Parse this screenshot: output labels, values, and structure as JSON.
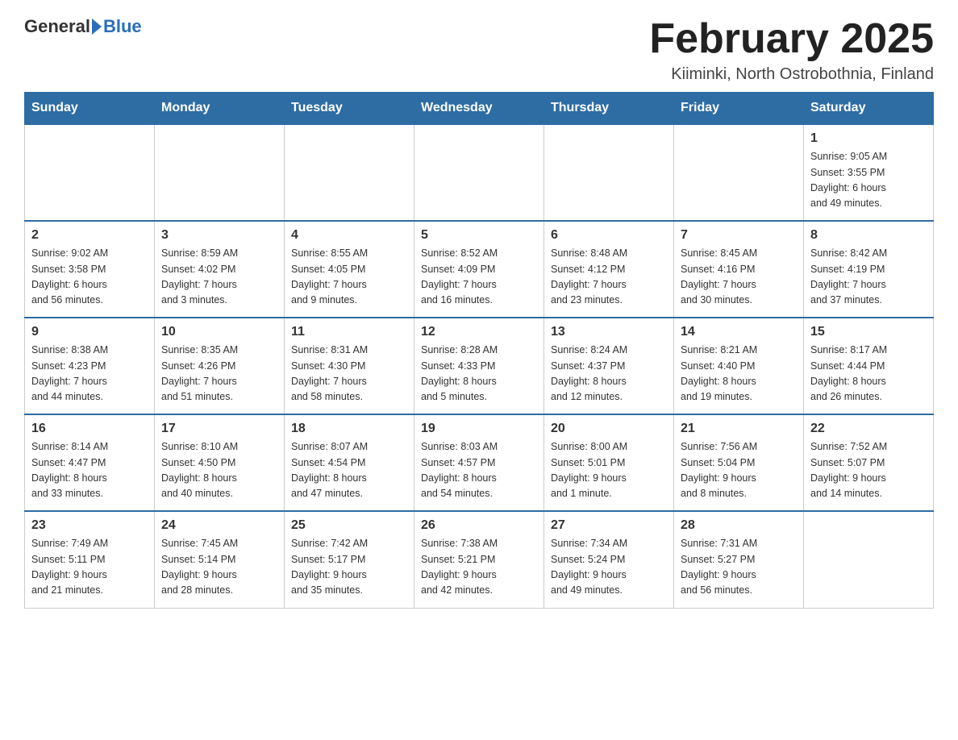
{
  "header": {
    "logo_general": "General",
    "logo_blue": "Blue",
    "month_title": "February 2025",
    "location": "Kiiminki, North Ostrobothnia, Finland"
  },
  "weekdays": [
    "Sunday",
    "Monday",
    "Tuesday",
    "Wednesday",
    "Thursday",
    "Friday",
    "Saturday"
  ],
  "weeks": [
    [
      {
        "day": "",
        "info": ""
      },
      {
        "day": "",
        "info": ""
      },
      {
        "day": "",
        "info": ""
      },
      {
        "day": "",
        "info": ""
      },
      {
        "day": "",
        "info": ""
      },
      {
        "day": "",
        "info": ""
      },
      {
        "day": "1",
        "info": "Sunrise: 9:05 AM\nSunset: 3:55 PM\nDaylight: 6 hours\nand 49 minutes."
      }
    ],
    [
      {
        "day": "2",
        "info": "Sunrise: 9:02 AM\nSunset: 3:58 PM\nDaylight: 6 hours\nand 56 minutes."
      },
      {
        "day": "3",
        "info": "Sunrise: 8:59 AM\nSunset: 4:02 PM\nDaylight: 7 hours\nand 3 minutes."
      },
      {
        "day": "4",
        "info": "Sunrise: 8:55 AM\nSunset: 4:05 PM\nDaylight: 7 hours\nand 9 minutes."
      },
      {
        "day": "5",
        "info": "Sunrise: 8:52 AM\nSunset: 4:09 PM\nDaylight: 7 hours\nand 16 minutes."
      },
      {
        "day": "6",
        "info": "Sunrise: 8:48 AM\nSunset: 4:12 PM\nDaylight: 7 hours\nand 23 minutes."
      },
      {
        "day": "7",
        "info": "Sunrise: 8:45 AM\nSunset: 4:16 PM\nDaylight: 7 hours\nand 30 minutes."
      },
      {
        "day": "8",
        "info": "Sunrise: 8:42 AM\nSunset: 4:19 PM\nDaylight: 7 hours\nand 37 minutes."
      }
    ],
    [
      {
        "day": "9",
        "info": "Sunrise: 8:38 AM\nSunset: 4:23 PM\nDaylight: 7 hours\nand 44 minutes."
      },
      {
        "day": "10",
        "info": "Sunrise: 8:35 AM\nSunset: 4:26 PM\nDaylight: 7 hours\nand 51 minutes."
      },
      {
        "day": "11",
        "info": "Sunrise: 8:31 AM\nSunset: 4:30 PM\nDaylight: 7 hours\nand 58 minutes."
      },
      {
        "day": "12",
        "info": "Sunrise: 8:28 AM\nSunset: 4:33 PM\nDaylight: 8 hours\nand 5 minutes."
      },
      {
        "day": "13",
        "info": "Sunrise: 8:24 AM\nSunset: 4:37 PM\nDaylight: 8 hours\nand 12 minutes."
      },
      {
        "day": "14",
        "info": "Sunrise: 8:21 AM\nSunset: 4:40 PM\nDaylight: 8 hours\nand 19 minutes."
      },
      {
        "day": "15",
        "info": "Sunrise: 8:17 AM\nSunset: 4:44 PM\nDaylight: 8 hours\nand 26 minutes."
      }
    ],
    [
      {
        "day": "16",
        "info": "Sunrise: 8:14 AM\nSunset: 4:47 PM\nDaylight: 8 hours\nand 33 minutes."
      },
      {
        "day": "17",
        "info": "Sunrise: 8:10 AM\nSunset: 4:50 PM\nDaylight: 8 hours\nand 40 minutes."
      },
      {
        "day": "18",
        "info": "Sunrise: 8:07 AM\nSunset: 4:54 PM\nDaylight: 8 hours\nand 47 minutes."
      },
      {
        "day": "19",
        "info": "Sunrise: 8:03 AM\nSunset: 4:57 PM\nDaylight: 8 hours\nand 54 minutes."
      },
      {
        "day": "20",
        "info": "Sunrise: 8:00 AM\nSunset: 5:01 PM\nDaylight: 9 hours\nand 1 minute."
      },
      {
        "day": "21",
        "info": "Sunrise: 7:56 AM\nSunset: 5:04 PM\nDaylight: 9 hours\nand 8 minutes."
      },
      {
        "day": "22",
        "info": "Sunrise: 7:52 AM\nSunset: 5:07 PM\nDaylight: 9 hours\nand 14 minutes."
      }
    ],
    [
      {
        "day": "23",
        "info": "Sunrise: 7:49 AM\nSunset: 5:11 PM\nDaylight: 9 hours\nand 21 minutes."
      },
      {
        "day": "24",
        "info": "Sunrise: 7:45 AM\nSunset: 5:14 PM\nDaylight: 9 hours\nand 28 minutes."
      },
      {
        "day": "25",
        "info": "Sunrise: 7:42 AM\nSunset: 5:17 PM\nDaylight: 9 hours\nand 35 minutes."
      },
      {
        "day": "26",
        "info": "Sunrise: 7:38 AM\nSunset: 5:21 PM\nDaylight: 9 hours\nand 42 minutes."
      },
      {
        "day": "27",
        "info": "Sunrise: 7:34 AM\nSunset: 5:24 PM\nDaylight: 9 hours\nand 49 minutes."
      },
      {
        "day": "28",
        "info": "Sunrise: 7:31 AM\nSunset: 5:27 PM\nDaylight: 9 hours\nand 56 minutes."
      },
      {
        "day": "",
        "info": ""
      }
    ]
  ]
}
